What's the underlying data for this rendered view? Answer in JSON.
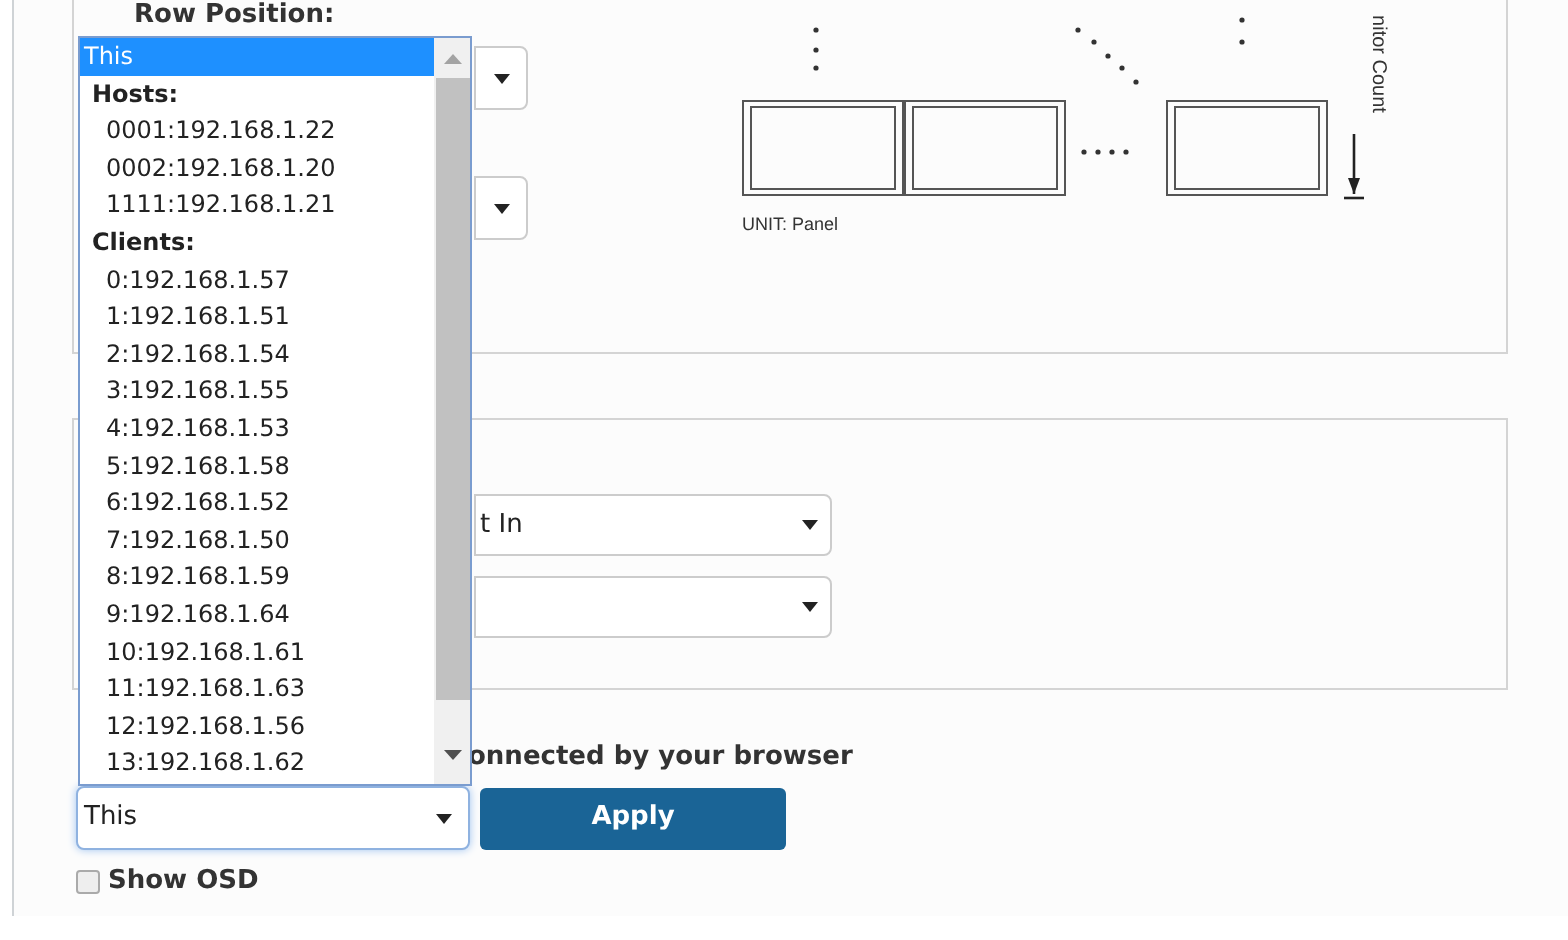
{
  "layout_panel": {
    "row_position_label": "Row Position:",
    "diagram": {
      "unit_label": "UNIT: Panel",
      "axis_label": "nitor Count"
    }
  },
  "input_panel": {
    "selects": [
      {
        "value": "t In"
      }
    ]
  },
  "source": {
    "note": "onnected by your browser",
    "select": {
      "value": "This",
      "expanded": true,
      "options": [
        {
          "kind": "option",
          "label": "This",
          "selected": true
        },
        {
          "kind": "group",
          "label": "Hosts:",
          "children": [
            {
              "label": "0001:192.168.1.22",
              "selected": false
            },
            {
              "label": "0002:192.168.1.20",
              "selected": false
            },
            {
              "label": "1111:192.168.1.21",
              "selected": false
            }
          ]
        },
        {
          "kind": "group",
          "label": "Clients:",
          "children": [
            {
              "label": "0:192.168.1.57",
              "selected": false
            },
            {
              "label": "1:192.168.1.51",
              "selected": false
            },
            {
              "label": "2:192.168.1.54",
              "selected": false
            },
            {
              "label": "3:192.168.1.55",
              "selected": false
            },
            {
              "label": "4:192.168.1.53",
              "selected": false
            },
            {
              "label": "5:192.168.1.58",
              "selected": false
            },
            {
              "label": "6:192.168.1.52",
              "selected": false
            },
            {
              "label": "7:192.168.1.50",
              "selected": false
            },
            {
              "label": "8:192.168.1.59",
              "selected": false
            },
            {
              "label": "9:192.168.1.64",
              "selected": false
            },
            {
              "label": "10:192.168.1.61",
              "selected": false
            },
            {
              "label": "11:192.168.1.63",
              "selected": false
            },
            {
              "label": "12:192.168.1.56",
              "selected": false
            },
            {
              "label": "13:192.168.1.62",
              "selected": false
            }
          ]
        }
      ]
    },
    "apply_button": "Apply"
  },
  "show_osd": {
    "label": "Show OSD",
    "checked": false
  }
}
